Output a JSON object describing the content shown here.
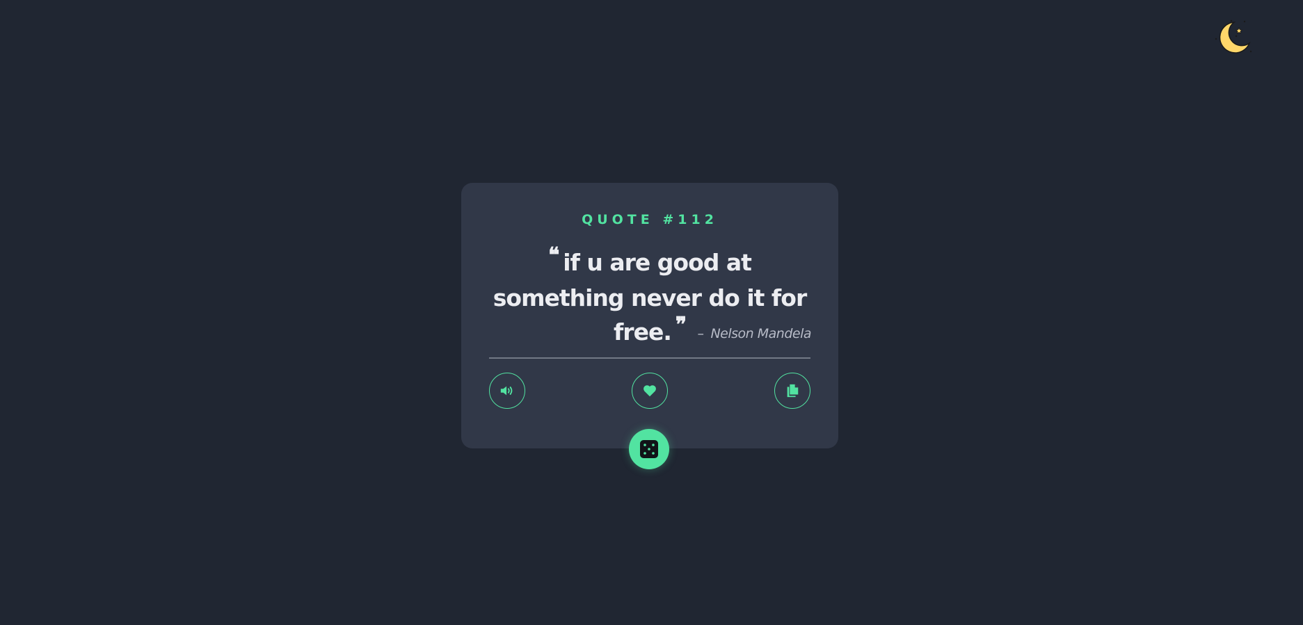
{
  "theme_toggle": {
    "icon": "moon-stars-icon",
    "color": "#ffd76a"
  },
  "card": {
    "quote_number": "QUOTE #112",
    "quote_text": "if u are good at something never do it for free.",
    "open_quote": "❝",
    "close_quote": "❞",
    "author_dash": "–",
    "author": "Nelson Mandela"
  },
  "actions": {
    "speak_icon": "speaker-icon",
    "like_icon": "heart-icon",
    "copy_icon": "copy-icon"
  },
  "random_button": {
    "icon": "dice-icon"
  },
  "colors": {
    "background": "#202632",
    "card": "#313848",
    "accent": "#52e3a1",
    "text": "#ecedf1",
    "muted": "#b8bcc8"
  }
}
